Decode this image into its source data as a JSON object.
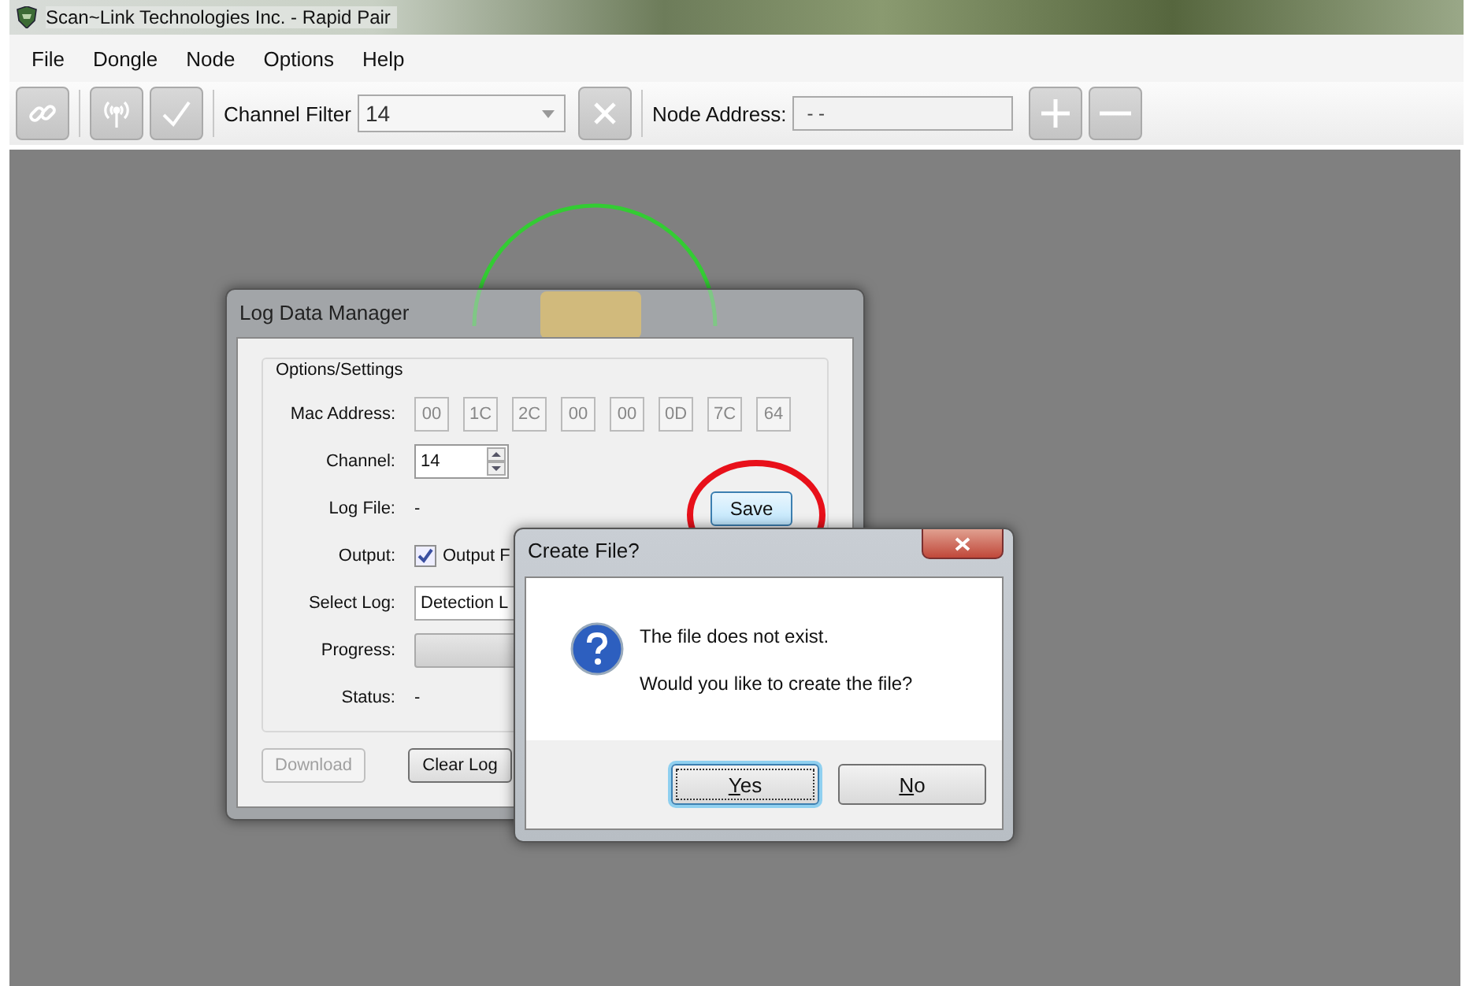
{
  "window": {
    "title": "Scan~Link Technologies Inc. - Rapid Pair"
  },
  "menu": [
    "File",
    "Dongle",
    "Node",
    "Options",
    "Help"
  ],
  "toolbar": {
    "channel_filter": {
      "label": "Channel Filter",
      "value": "14"
    },
    "node_address": {
      "label": "Node Address:",
      "value": "- -"
    }
  },
  "log_manager": {
    "title": "Log Data Manager",
    "group": "Options/Settings",
    "mac_label": "Mac Address:",
    "mac": [
      "00",
      "1C",
      "2C",
      "00",
      "00",
      "0D",
      "7C",
      "64"
    ],
    "channel": {
      "label": "Channel:",
      "value": "14"
    },
    "log_file": {
      "label": "Log File:",
      "value": "-"
    },
    "save": "Save",
    "output": {
      "label": "Output:",
      "checkbox_label": "Output F",
      "checked": true
    },
    "select_log": {
      "label": "Select Log:",
      "value": "Detection L"
    },
    "progress": {
      "label": "Progress:",
      "level": 0
    },
    "status": {
      "label": "Status:",
      "value": "-"
    },
    "buttons": [
      {
        "label": "Download",
        "disabled": true
      },
      {
        "label": "Clear Log",
        "disabled": false
      }
    ]
  },
  "dialog": {
    "title": "Create File?",
    "lines": [
      "The file does not exist.",
      "Would you like to create the file?"
    ],
    "buttons": [
      {
        "label": "Yes",
        "selected": true
      },
      {
        "label": "No",
        "selected": false
      }
    ]
  }
}
